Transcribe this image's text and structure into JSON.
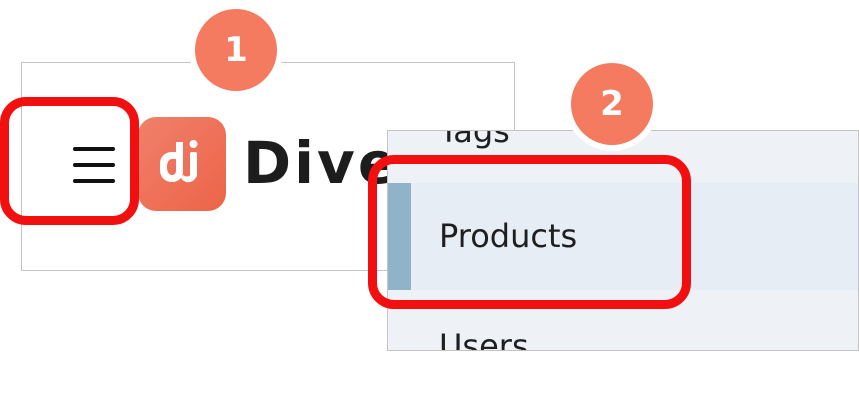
{
  "header": {
    "brand_name": "Dive",
    "menu_icon": "hamburger-menu-icon",
    "logo_icon": "dive-logo-mark"
  },
  "menu": {
    "items": [
      {
        "label": "Tags",
        "active": false
      },
      {
        "label": "Products",
        "active": true
      },
      {
        "label": "Users",
        "active": false
      }
    ]
  },
  "steps": [
    {
      "number": "1"
    },
    {
      "number": "2"
    }
  ],
  "colors": {
    "highlight": "#f20f0f",
    "badge": "#f47a60",
    "brand": "#ec6448",
    "active_bar": "#8fb3c9",
    "menu_background": "#eef2f7"
  }
}
